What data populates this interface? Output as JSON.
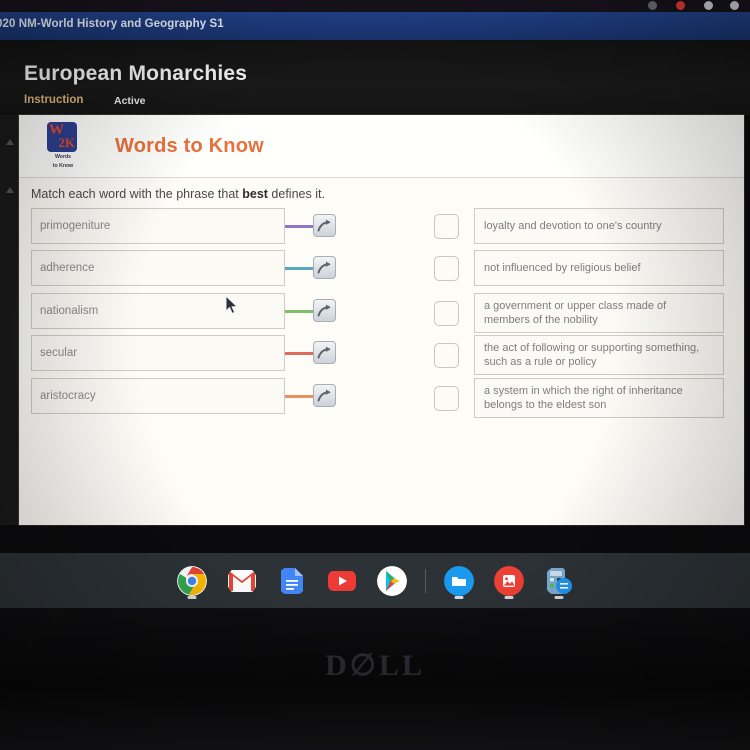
{
  "browser": {
    "tab_dots": [
      "#6b6b78",
      "#e03b2f",
      "#cfcfd6",
      "#cfcfd6"
    ]
  },
  "titlebar": {
    "course": "020 NM-World History and Geography S1",
    "background": "#1c3a7a"
  },
  "lesson": {
    "title": "European Monarchies",
    "kicker": "Instruction",
    "status": "Active",
    "kicker_color": "#e0b67a"
  },
  "card": {
    "badge": {
      "line1": "W",
      "line2": "2K",
      "caption_1": "Words",
      "caption_2": "to Know"
    },
    "title": "Words to Know",
    "title_color": "#e8713c",
    "prompt_before": "Match each word with the phrase that ",
    "prompt_bold": "best",
    "prompt_after": " defines it."
  },
  "match": {
    "words": [
      {
        "label": "primogeniture",
        "connector_color": "#8f79c4"
      },
      {
        "label": "adherence",
        "connector_color": "#5aa7c0"
      },
      {
        "label": "nationalism",
        "connector_color": "#7fbf6a"
      },
      {
        "label": "secular",
        "connector_color": "#e06a5e"
      },
      {
        "label": "aristocracy",
        "connector_color": "#e8915e"
      }
    ],
    "arrow_icon": "arrow-curve-right-icon",
    "definitions": [
      {
        "text": "loyalty and devotion to one's country",
        "checked": false
      },
      {
        "text": "not influenced by religious belief",
        "checked": false
      },
      {
        "text": "a government or upper class made of members of the nobility",
        "checked": false
      },
      {
        "text": "the act of following or supporting something, such as a rule or policy",
        "checked": false
      },
      {
        "text": "a system in which the right of inheritance belongs to the eldest son",
        "checked": false
      }
    ]
  },
  "shelf": {
    "items": [
      {
        "name": "chrome-icon",
        "label": "Chrome",
        "running": true
      },
      {
        "name": "gmail-icon",
        "label": "Gmail",
        "running": false
      },
      {
        "name": "google-docs-icon",
        "label": "Docs",
        "running": false
      },
      {
        "name": "youtube-icon",
        "label": "YouTube",
        "running": false
      },
      {
        "name": "play-store-icon",
        "label": "Play Store",
        "running": false
      },
      {
        "name": "files-icon",
        "label": "Files",
        "running": true
      },
      {
        "name": "photos-icon",
        "label": "Photos",
        "running": true
      },
      {
        "name": "calculator-icon",
        "label": "Calculator",
        "running": true
      }
    ],
    "background": "#2c3236"
  },
  "device": {
    "brand": "D∅LL"
  }
}
